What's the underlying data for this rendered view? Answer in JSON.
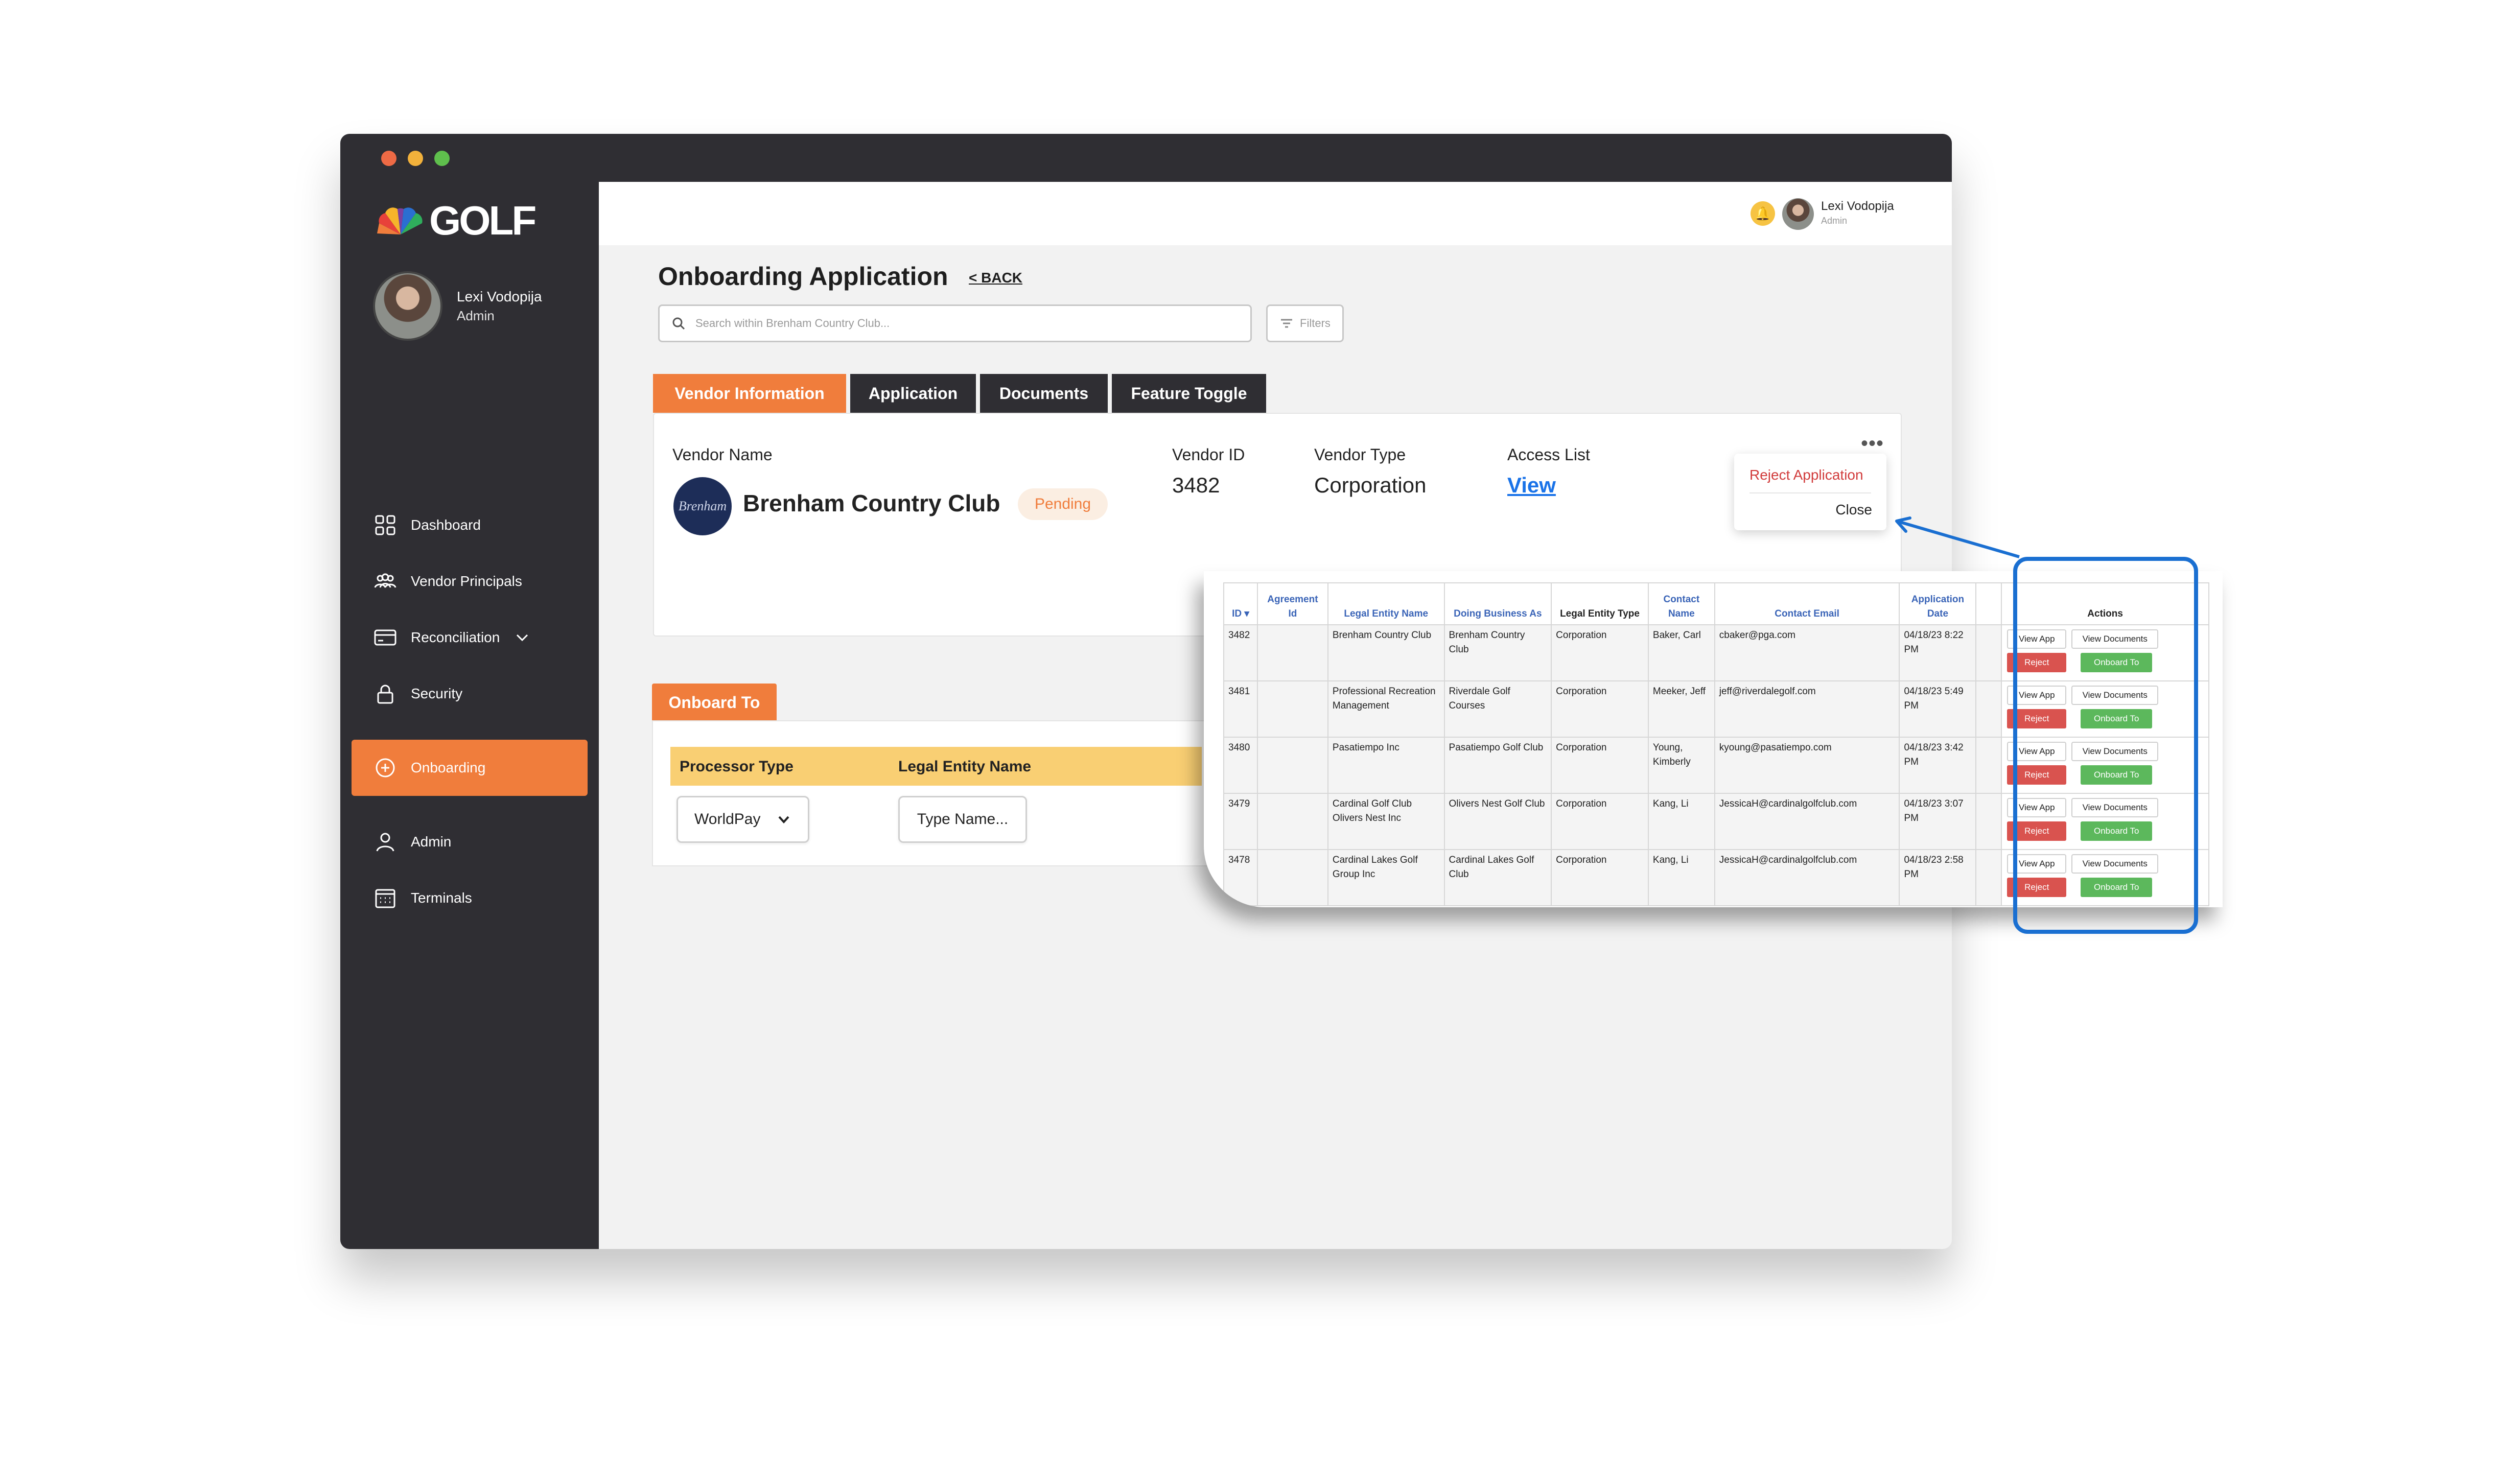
{
  "brand": {
    "logo_text": "GOLF"
  },
  "user": {
    "name": "Lexi Vodopija",
    "role": "Admin"
  },
  "sidebar": {
    "items": [
      {
        "label": "Dashboard",
        "icon": "dashboard-icon"
      },
      {
        "label": "Vendor Principals",
        "icon": "users-icon"
      },
      {
        "label": "Reconciliation",
        "icon": "card-icon"
      },
      {
        "label": "Security",
        "icon": "lock-icon"
      },
      {
        "label": "Onboarding",
        "icon": "plus-circle-icon",
        "active": true
      },
      {
        "label": "Admin",
        "icon": "user-icon"
      },
      {
        "label": "Terminals",
        "icon": "calendar-icon"
      }
    ]
  },
  "page": {
    "title": "Onboarding Application",
    "back_label": "< BACK",
    "search_placeholder": "Search within Brenham Country Club...",
    "filters_label": "Filters"
  },
  "tabs": [
    {
      "label": "Vendor Information",
      "active": true
    },
    {
      "label": "Application"
    },
    {
      "label": "Documents"
    },
    {
      "label": "Feature Toggle"
    }
  ],
  "vendor": {
    "name_label": "Vendor Name",
    "name": "Brenham Country Club",
    "logo_text": "Brenham",
    "status": "Pending",
    "id_label": "Vendor ID",
    "id": "3482",
    "type_label": "Vendor Type",
    "type": "Corporation",
    "access_label": "Access List",
    "access_link": "View",
    "menu": {
      "reject": "Reject Application",
      "close": "Close"
    }
  },
  "onboard": {
    "tab_label": "Onboard To",
    "processor_header": "Processor Type",
    "entity_header": "Legal Entity Name",
    "processor_value": "WorldPay",
    "entity_placeholder": "Type Name..."
  },
  "grid": {
    "headers": [
      "ID ▾",
      "Agreement Id",
      "Legal Entity Name",
      "Doing Business As",
      "Legal Entity Type",
      "Contact Name",
      "Contact Email",
      "Application Date",
      "",
      "Actions"
    ],
    "rows": [
      {
        "id": "3482",
        "agreement": "",
        "legal": "Brenham Country Club",
        "dba": "Brenham Country Club",
        "type": "Corporation",
        "contact": "Baker, Carl",
        "email": "cbaker@pga.com",
        "date": "04/18/23 8:22 PM"
      },
      {
        "id": "3481",
        "agreement": "",
        "legal": "Professional Recreation Management",
        "dba": "Riverdale Golf Courses",
        "type": "Corporation",
        "contact": "Meeker, Jeff",
        "email": "jeff@riverdalegolf.com",
        "date": "04/18/23 5:49 PM"
      },
      {
        "id": "3480",
        "agreement": "",
        "legal": "Pasatiempo Inc",
        "dba": "Pasatiempo Golf Club",
        "type": "Corporation",
        "contact": "Young, Kimberly",
        "email": "kyoung@pasatiempo.com",
        "date": "04/18/23 3:42 PM"
      },
      {
        "id": "3479",
        "agreement": "",
        "legal": "Cardinal Golf Club Olivers Nest Inc",
        "dba": "Olivers Nest Golf Club",
        "type": "Corporation",
        "contact": "Kang, Li",
        "email": "JessicaH@cardinalgolfclub.com",
        "date": "04/18/23 3:07 PM"
      },
      {
        "id": "3478",
        "agreement": "",
        "legal": "Cardinal Lakes Golf Group Inc",
        "dba": "Cardinal Lakes Golf Club",
        "type": "Corporation",
        "contact": "Kang, Li",
        "email": "JessicaH@cardinalgolfclub.com",
        "date": "04/18/23 2:58 PM"
      }
    ],
    "actions": {
      "view_app": "View App",
      "view_docs": "View Documents",
      "reject": "Reject",
      "onboard": "Onboard To"
    }
  },
  "colors": {
    "accent": "#f07d3c",
    "sidebar": "#2f2e33",
    "link": "#1a73e8",
    "highlight": "#1a6fd1",
    "reject": "#d9534f",
    "onboard": "#5cb85c"
  }
}
